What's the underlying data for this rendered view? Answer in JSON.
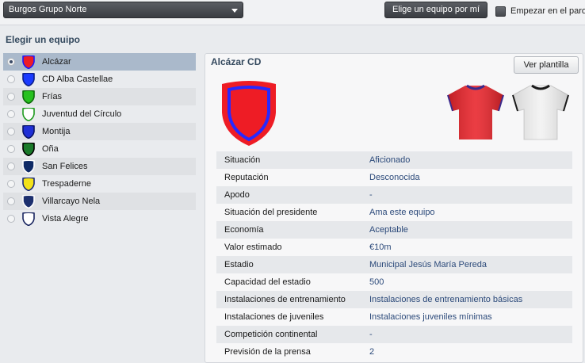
{
  "topbar": {
    "league_value": "Burgos Grupo Norte",
    "pick_button": "Elige un equipo por mí",
    "start_label": "Empezar en el paro"
  },
  "section_title": "Elegir un equipo",
  "teams": [
    {
      "name": "Alcázar",
      "color": "#ee1c25",
      "trim": "#1a1aff",
      "selected": true
    },
    {
      "name": "CD Alba Castellae",
      "color": "#1b3bff",
      "trim": "#0d1f8a",
      "selected": false
    },
    {
      "name": "Frías",
      "color": "#27c11f",
      "trim": "#0e6b0b",
      "selected": false
    },
    {
      "name": "Juventud del Círculo",
      "color": "#ffffff",
      "trim": "#1e9a1e",
      "selected": false
    },
    {
      "name": "Montija",
      "color": "#1f2fd6",
      "trim": "#0a1466",
      "selected": false
    },
    {
      "name": "Oña",
      "color": "#1a7a2a",
      "trim": "#000000",
      "selected": false
    },
    {
      "name": "San Felices",
      "color": "#0f2a66",
      "trim": "#ffffff",
      "selected": false
    },
    {
      "name": "Trespaderne",
      "color": "#f3e21a",
      "trim": "#1b2a7a",
      "selected": false
    },
    {
      "name": "Villarcayo Nela",
      "color": "#1c2f6e",
      "trim": "#ffffff",
      "selected": false
    },
    {
      "name": "Vista Alegre",
      "color": "#ffffff",
      "trim": "#1a2660",
      "selected": false
    }
  ],
  "club": {
    "title": "Alcázar CD",
    "squad_button": "Ver plantilla",
    "crest_color": "#ee1c25",
    "crest_trim": "#2828ff",
    "home_kit_color": "#e8232a",
    "away_kit_color": "#f2f2f2",
    "info": [
      {
        "label": "Situación",
        "value": "Aficionado"
      },
      {
        "label": "Reputación",
        "value": "Desconocida"
      },
      {
        "label": "Apodo",
        "value": "-"
      },
      {
        "label": "Situación del presidente",
        "value": "Ama este equipo"
      },
      {
        "label": "Economía",
        "value": "Aceptable"
      },
      {
        "label": "Valor estimado",
        "value": "€10m"
      },
      {
        "label": "Estadio",
        "value": "Municipal Jesús María Pereda"
      },
      {
        "label": "Capacidad del estadio",
        "value": "500"
      },
      {
        "label": "Instalaciones de entrenamiento",
        "value": "Instalaciones de entrenamiento básicas"
      },
      {
        "label": "Instalaciones de juveniles",
        "value": "Instalaciones juveniles mínimas"
      },
      {
        "label": "Competición continental",
        "value": "-"
      },
      {
        "label": "Previsión de la prensa",
        "value": "2"
      }
    ]
  }
}
